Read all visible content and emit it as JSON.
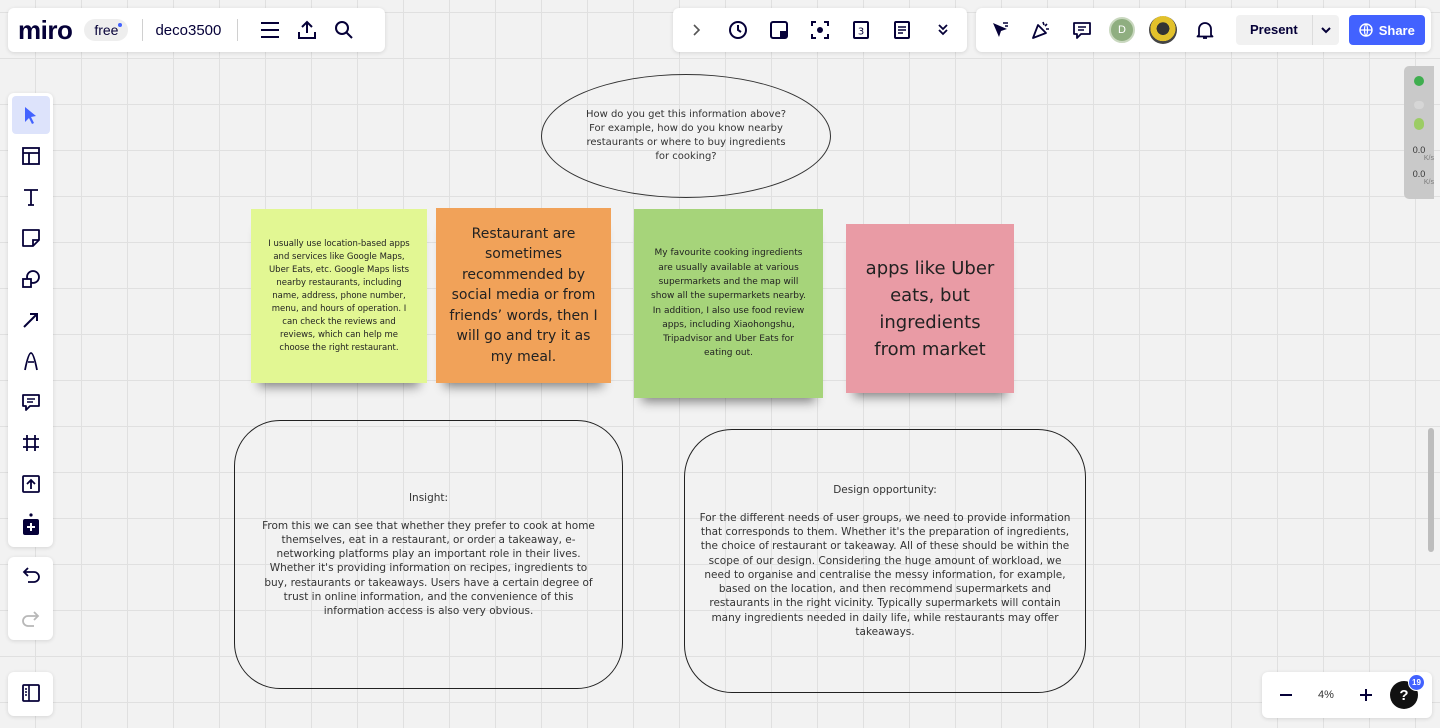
{
  "app": {
    "logo": "miro",
    "plan": "free",
    "board_name": "deco3500"
  },
  "top_left_icons": [
    "menu-icon",
    "upload-icon",
    "search-icon"
  ],
  "toolbar_center_icons": [
    "chevron-right-icon",
    "timer-icon",
    "note-add-icon",
    "focus-icon",
    "count-icon",
    "notes-icon",
    "chevrons-down-icon"
  ],
  "top_right": {
    "avatar_initial": "D",
    "present_label": "Present",
    "share_label": "Share"
  },
  "left_tools": [
    "select-icon",
    "templates-icon",
    "text-icon",
    "sticky-note-icon",
    "shapes-icon",
    "arrow-icon",
    "pen-icon",
    "comment-icon",
    "frame-icon",
    "upload-icon",
    "more-apps-icon"
  ],
  "canvas": {
    "question": "How do you get this information above? For example, how do you know nearby restaurants or where to buy ingredients for cooking?",
    "stickies": [
      {
        "text": "I usually use location-based apps and services like Google Maps, Uber Eats, etc. Google Maps lists nearby restaurants, including name, address, phone number, menu, and hours of operation. I can check the reviews and reviews, which can help me choose the right restaurant.",
        "color": "#e2f793"
      },
      {
        "text": "Restaurant are sometimes recommended by social media or from friends’ words, then I will go and try it as my meal.",
        "color": "#f1a259"
      },
      {
        "text": "My favourite cooking ingredients are usually available at various supermarkets and the map will show all the supermarkets nearby. In addition, I also use food review apps, including Xiaohongshu, Tripadvisor and Uber Eats for eating out.",
        "color": "#a6d47a"
      },
      {
        "text": "apps like Uber eats, but ingredients from market",
        "color": "#e99ba5"
      }
    ],
    "insight": {
      "title": "Insight:",
      "body": "From this we can see that whether they prefer to cook at home themselves, eat in a restaurant, or order a takeaway, e-networking platforms play an important role in their lives. Whether it's providing information on recipes, ingredients to buy, restaurants or takeaways. Users have a certain degree of trust in online information, and the convenience of this information access is also very obvious."
    },
    "opportunity": {
      "title": "Design opportunity:",
      "body": "For the different needs of user groups, we need to provide information that corresponds to them. Whether it's the preparation of ingredients, the choice of restaurant or takeaway. All of these should be within the scope of our design. Considering the huge amount of workload, we need to organise and centralise the messy information, for example, based on the location, and then recommend supermarkets and restaurants in the right vicinity. Typically supermarkets will contain many ingredients needed in daily life, while restaurants may offer takeaways."
    }
  },
  "network": {
    "down_value": "0.0",
    "down_unit": "K/s",
    "up_value": "0.0",
    "up_unit": "K/s"
  },
  "zoom": {
    "level": "4%",
    "help_badge": "19"
  },
  "colors": {
    "accent": "#4262ff"
  }
}
